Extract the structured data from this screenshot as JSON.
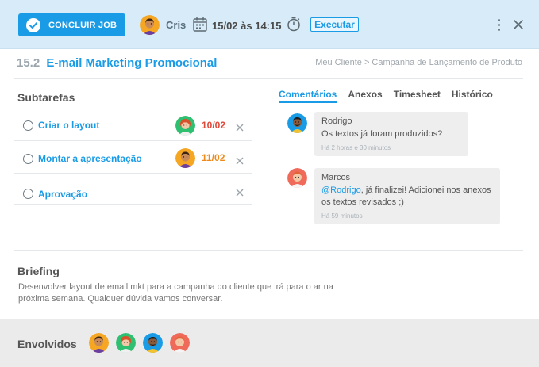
{
  "header": {
    "conclude_label": "CONCLUIR JOB",
    "user_name": "Cris",
    "datetime": "15/02 às 14:15",
    "execute_label": "Executar"
  },
  "job": {
    "number": "15.2",
    "title": "E-mail Marketing Promocional",
    "breadcrumb": "Meu Cliente > Campanha de Lançamento de Produto"
  },
  "subtasks": {
    "heading": "Subtarefas",
    "items": [
      {
        "name": "Criar o layout",
        "due": "10/02",
        "due_color": "#e04a3a",
        "avatar": "green-woman"
      },
      {
        "name": "Montar a apresentação",
        "due": "11/02",
        "due_color": "#ef8a1a",
        "avatar": "orange-man"
      },
      {
        "name": "Aprovação",
        "due": "",
        "due_color": "",
        "avatar": ""
      }
    ]
  },
  "tabs": [
    "Comentários",
    "Anexos",
    "Timesheet",
    "Histórico"
  ],
  "active_tab": "Comentários",
  "comments": [
    {
      "author": "Rodrigo",
      "body": "Os textos já foram produzidos?",
      "time": "Há 2 horas e 30 minutos",
      "avatar": "blue-man"
    },
    {
      "author": "Marcos",
      "mention": "@Rodrigo",
      "body": ", já finalizei! Adicionei nos anexos os textos revisados ;)",
      "time": "Há 59 minutos",
      "avatar": "red-woman"
    }
  ],
  "briefing": {
    "heading": "Briefing",
    "text": "Desenvolver layout de email mkt para a campanha do cliente que irá para o ar na próxima semana. Qualquer dúvida vamos conversar."
  },
  "footer": {
    "label": "Envolvidos",
    "people": [
      "orange-man",
      "green-woman",
      "blue-man",
      "red-woman"
    ]
  },
  "colors": {
    "accent": "#1a9be6",
    "topbar_bg": "#d7ecf8",
    "due_red": "#e04a3a",
    "due_orange": "#ef8a1a"
  }
}
